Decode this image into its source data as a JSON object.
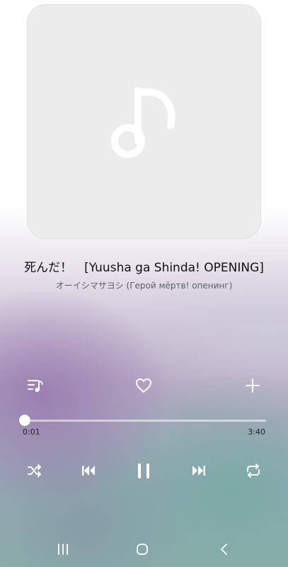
{
  "track": {
    "title": "死んだ！　[Yuusha ga Shinda! OPENING]",
    "artist": "オーイシマサヨシ (Герой мёртв! опенинг)"
  },
  "progress": {
    "elapsed": "0:01",
    "total": "3:40",
    "fraction": 0.005
  },
  "icons": {
    "album_placeholder": "music-note-icon",
    "queue": "playlist-icon",
    "favorite": "heart-icon",
    "add": "plus-icon",
    "shuffle": "shuffle-icon",
    "previous": "skip-previous-icon",
    "play_pause": "pause-icon",
    "next": "skip-next-icon",
    "repeat": "repeat-icon",
    "nav_recents": "recents-icon",
    "nav_home": "home-icon",
    "nav_back": "back-icon"
  },
  "colors": {
    "album_bg": "#ececec",
    "note": "#ffffff",
    "control_icons": "#ffffff"
  }
}
